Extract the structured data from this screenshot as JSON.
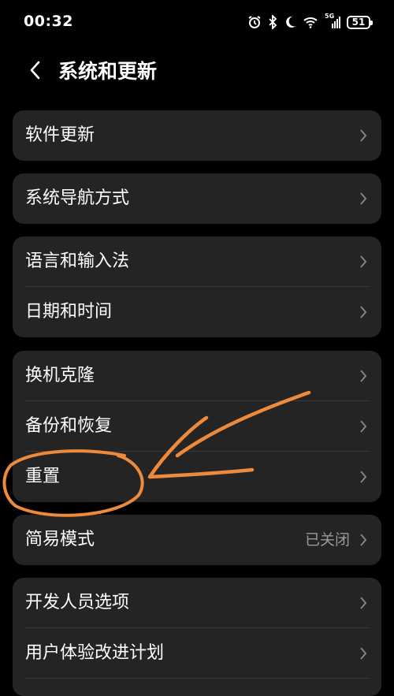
{
  "status_bar": {
    "time": "00:32",
    "network": "5G",
    "battery": "51",
    "icons": [
      "alarm-icon",
      "bluetooth-icon",
      "moon-icon",
      "wifi-icon",
      "cellular-signal-icon",
      "battery-icon"
    ]
  },
  "header": {
    "title": "系统和更新",
    "back_icon": "chevron-left-icon"
  },
  "groups": [
    {
      "items": [
        {
          "label": "软件更新"
        }
      ]
    },
    {
      "items": [
        {
          "label": "系统导航方式"
        }
      ]
    },
    {
      "items": [
        {
          "label": "语言和输入法"
        },
        {
          "label": "日期和时间"
        }
      ]
    },
    {
      "items": [
        {
          "label": "换机克隆"
        },
        {
          "label": "备份和恢复"
        },
        {
          "label": "重置"
        }
      ]
    },
    {
      "items": [
        {
          "label": "简易模式",
          "value": "已关闭"
        }
      ]
    },
    {
      "items": [
        {
          "label": "开发人员选项"
        },
        {
          "label": "用户体验改进计划"
        }
      ]
    }
  ],
  "annotation": {
    "color": "#ee8a3c",
    "description_icons": [
      "circle-highlight",
      "arrow"
    ]
  }
}
